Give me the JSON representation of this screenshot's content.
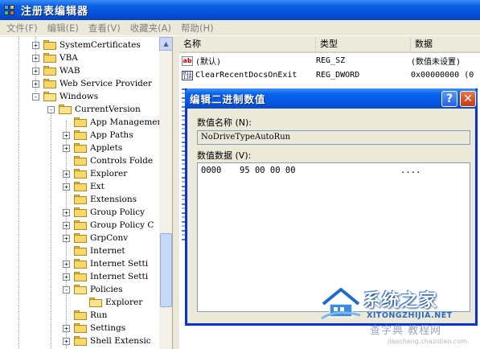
{
  "window": {
    "title": "注册表编辑器"
  },
  "menu": [
    {
      "label": "文件(F)"
    },
    {
      "label": "编辑(E)"
    },
    {
      "label": "查看(V)"
    },
    {
      "label": "收藏夹(A)"
    },
    {
      "label": "帮助(H)"
    }
  ],
  "tree": {
    "items": [
      {
        "label": "SystemCertificates",
        "expander": "+"
      },
      {
        "label": "VBA",
        "expander": "+"
      },
      {
        "label": "WAB",
        "expander": "+"
      },
      {
        "label": "Web Service Provider",
        "expander": "+"
      },
      {
        "label": "Windows",
        "expander": "-"
      },
      {
        "label": "CurrentVersion",
        "expander": "-"
      },
      {
        "label": "App Management",
        "expander": ""
      },
      {
        "label": "App Paths",
        "expander": "+"
      },
      {
        "label": "Applets",
        "expander": "+"
      },
      {
        "label": "Controls Folde",
        "expander": ""
      },
      {
        "label": "Explorer",
        "expander": "+"
      },
      {
        "label": "Ext",
        "expander": "+"
      },
      {
        "label": "Extensions",
        "expander": ""
      },
      {
        "label": "Group Policy",
        "expander": "+"
      },
      {
        "label": "Group Policy C",
        "expander": "+"
      },
      {
        "label": "GrpConv",
        "expander": "+"
      },
      {
        "label": "Internet",
        "expander": ""
      },
      {
        "label": "Internet Setti",
        "expander": "+"
      },
      {
        "label": "Internet Setti",
        "expander": "+"
      },
      {
        "label": "Policies",
        "expander": "-"
      },
      {
        "label": "Explorer",
        "expander": ""
      },
      {
        "label": "Run",
        "expander": ""
      },
      {
        "label": "Settings",
        "expander": "+"
      },
      {
        "label": "Shell Extensic",
        "expander": "+"
      }
    ]
  },
  "list": {
    "headers": {
      "name": "名称",
      "type": "类型",
      "data": "数据"
    },
    "rows": [
      {
        "icon": "ab",
        "name": "(默认)",
        "type": "REG_SZ",
        "data": "(数值未设置)"
      },
      {
        "icon": "bin",
        "name": "ClearRecentDocsOnExit",
        "type": "REG_DWORD",
        "data": "0x00000000 (0"
      }
    ]
  },
  "dialog": {
    "title": "编辑二进制数值",
    "help_button": "?",
    "close_button": "✕",
    "name_label": "数值名称",
    "name_key": "(N):",
    "name_value": "NoDriveTypeAutoRun",
    "data_label": "数值数据",
    "data_key": "(V):",
    "offset": "0000",
    "hex": "95  00  00  00",
    "ascii": "...."
  },
  "watermark": {
    "brand": "系统之家",
    "pinyin": "XITONGZHIJIA.NET",
    "site2": "查字典 教程网",
    "site3": "jiaocheng.chazidian.com"
  },
  "colors": {
    "title_bar": "#0550dc",
    "dialog_border": "#0831d9",
    "close_button": "#c83810",
    "window_bg": "#ece9d8"
  }
}
